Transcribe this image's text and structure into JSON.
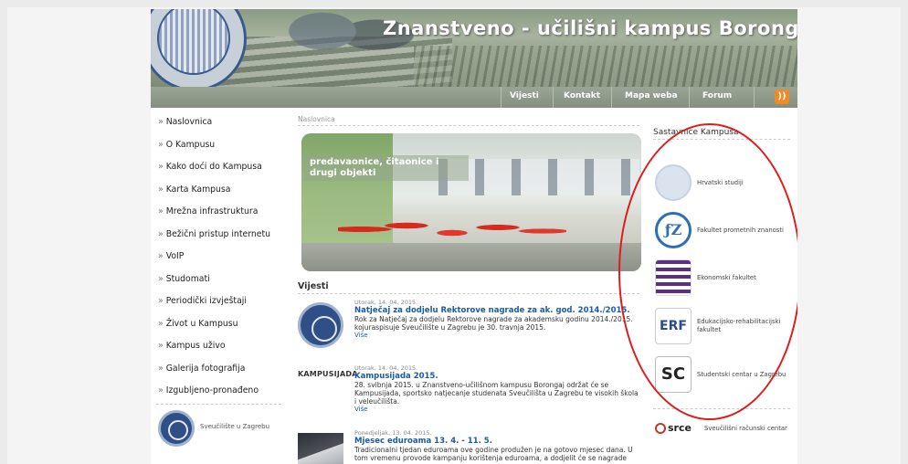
{
  "header": {
    "site_title": "Znanstveno - učilišni kampus Borongaj",
    "nav": [
      "Vijesti",
      "Kontakt",
      "Mapa weba",
      "Forum"
    ],
    "rss_icon": "rss-icon"
  },
  "left_menu": {
    "items": [
      "Naslovnica",
      "O Kampusu",
      "Kako doći do Kampusa",
      "Karta Kampusa",
      "Mrežna infrastruktura",
      "Bežični pristup internetu",
      "VoIP",
      "Studomati",
      "Periodički izvještaji",
      "Život u Kampusu",
      "Kampus uživo",
      "Galerija fotografija",
      "Izgubljeno-pronađeno"
    ],
    "badge_label": "Sveučilište u Zagrebu"
  },
  "main": {
    "breadcrumb": "Naslovnica",
    "hero_caption": "predavaonice, čitaonice i drugi objekti",
    "news_heading": "Vijesti",
    "news": [
      {
        "date": "Utorak, 14. 04. 2015.",
        "title": "Natječaj za dodjelu Rektorove nagrade za ak. god. 2014./2015.",
        "text": "Rok za Natječaj za dodjelu Rektorove nagrade za akademsku godinu 2014./2015. kojuraspisuje Sveučilište u Zagrebu je 30. travnja 2015.",
        "more": "Više"
      },
      {
        "date": "Utorak, 14. 04. 2015.",
        "title": "Kampusijada 2015.",
        "image_label": "KAMPUSIJADA",
        "text": "28. svibnja 2015. u Znanstveno-učilišnom kampusu Borongaj održat će se Kampusijada, sportsko natjecanje studenata Sveučilišta u Zagrebu te visokih škola i veleučilišta.",
        "more": "Više"
      },
      {
        "date": "Ponedjeljak, 13. 04. 2015.",
        "title": "Mjesec eduroama 13. 4. - 11. 5.",
        "text": "Tradicionalni tjedan eduroama ove godine produžen je na gotovo mjesec dana. U tom vremenu provode kampanju korištenja eduroama, a dodjelit će se nagrade",
        "more": ""
      }
    ]
  },
  "right_sidebar": {
    "heading": "Sastavnice Kampusa",
    "items": [
      {
        "label": "Hrvatski studiji",
        "icon": "hrvatski-studiji-logo-icon"
      },
      {
        "label": "Fakultet prometnih znanosti",
        "icon": "fpz-logo-icon",
        "icon_text": "ƒZ"
      },
      {
        "label": "Ekonomski fakultet",
        "icon": "ekonomski-logo-icon"
      },
      {
        "label_line1": "Edukacijsko-rehabilitacijski",
        "label_line2": "fakultet",
        "icon": "erf-logo-icon",
        "icon_text": "ERF"
      },
      {
        "label": "Studentski centar u Zagrebu",
        "icon": "sc-logo-icon",
        "icon_text": "SC"
      },
      {
        "label": "Sveučilišni računski centar",
        "icon": "srce-logo-icon",
        "icon_text": "srce"
      }
    ]
  },
  "colors": {
    "link_blue": "#1a5aa8",
    "annotation_red": "#e01b1b",
    "nav_bar": "#8d9887",
    "rss_orange": "#f08a24"
  }
}
